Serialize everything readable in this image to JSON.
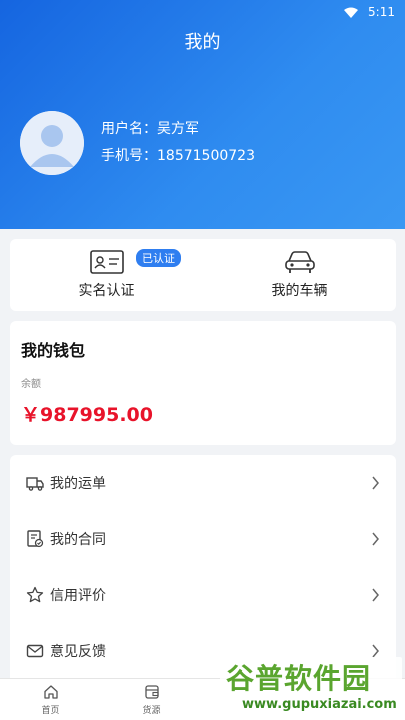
{
  "status": {
    "time": "5:11"
  },
  "header": {
    "title": "我的"
  },
  "user": {
    "name_label": "用户名：",
    "name": "吴方军",
    "phone_label": "手机号：",
    "phone": "18571500723"
  },
  "auth": {
    "realname_label": "实名认证",
    "badge": "已认证",
    "vehicle_label": "我的车辆"
  },
  "wallet": {
    "title": "我的钱包",
    "balance_label": "余额",
    "balance": "￥987995.00"
  },
  "menu": [
    {
      "label": "我的运单",
      "icon": "truck-icon"
    },
    {
      "label": "我的合同",
      "icon": "contract-icon"
    },
    {
      "label": "信用评价",
      "icon": "star-icon"
    },
    {
      "label": "意见反馈",
      "icon": "mail-icon"
    }
  ],
  "tabs": [
    {
      "label": "首页",
      "icon": "home-icon"
    },
    {
      "label": "货源",
      "icon": "wallet-icon"
    }
  ],
  "watermark": {
    "title": "谷普软件园",
    "url": "www.gupuxiazai.com"
  },
  "colors": {
    "accent": "#2f7ef0",
    "amount": "#e8132a"
  }
}
